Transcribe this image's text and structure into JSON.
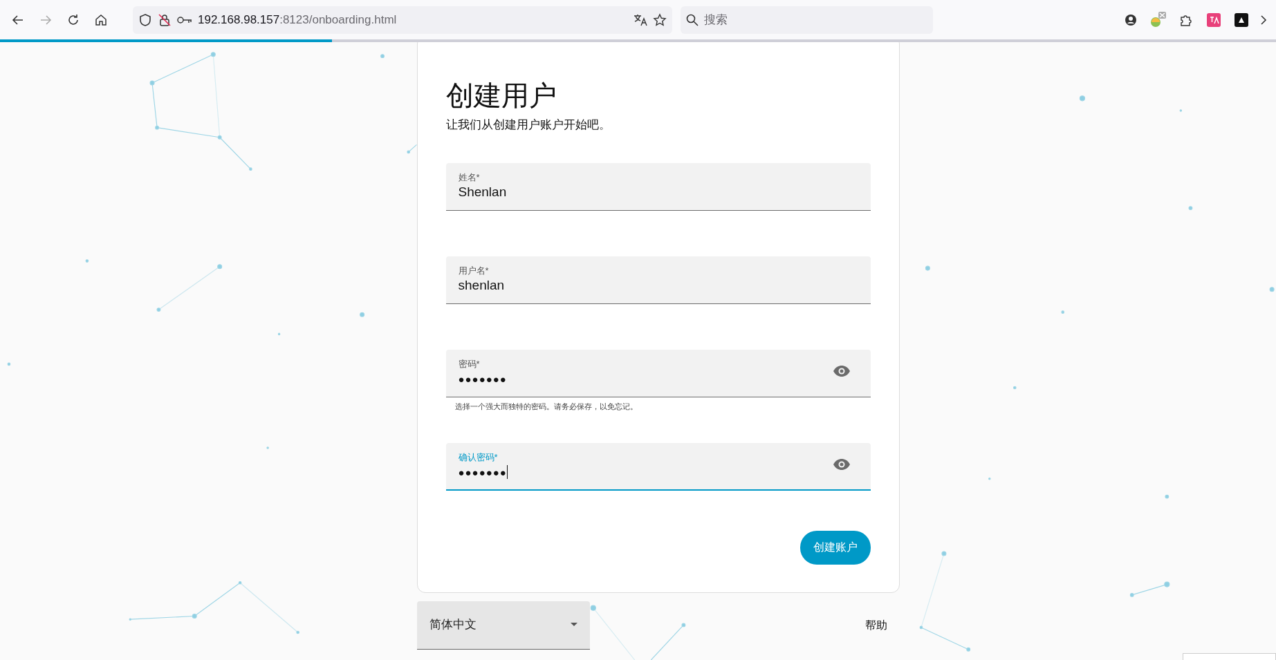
{
  "browser": {
    "url": {
      "host": "192.168.98.157",
      "path": ":8123/onboarding.html"
    },
    "search": {
      "placeholder": "搜索"
    },
    "loading": {
      "level": 0.26
    }
  },
  "card": {
    "title": "创建用户",
    "subtitle": "让我们从创建用户账户开始吧。",
    "fields": [
      {
        "kind": "text",
        "label": "姓名*",
        "value": "Shenlan",
        "focused": false
      },
      {
        "kind": "text",
        "label": "用户名*",
        "value": "shenlan",
        "focused": false
      },
      {
        "kind": "password",
        "label": "密码*",
        "value": "●●●●●●●",
        "focused": false,
        "helper": "选择一个强大而独特的密码。请务必保存，以免忘记。"
      },
      {
        "kind": "password",
        "label": "确认密码*",
        "value": "●●●●●●●",
        "focused": true
      }
    ],
    "button": "创建账户"
  },
  "footer": {
    "language": "简体中文",
    "help": "帮助"
  }
}
